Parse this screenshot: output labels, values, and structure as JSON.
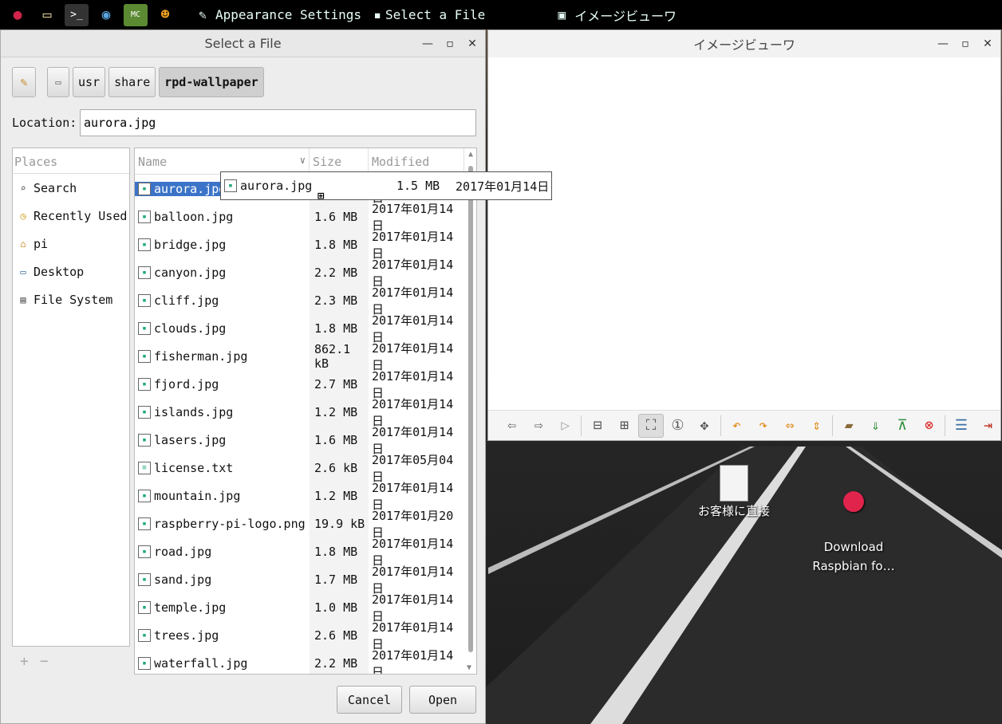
{
  "taskbar": {
    "launchers": [
      "raspberry-menu",
      "file-manager",
      "terminal",
      "chromium",
      "minecraft",
      "scratch"
    ],
    "tasks": [
      {
        "label": "Appearance Settings"
      },
      {
        "label": "Select a File"
      },
      {
        "label": "イメージビューワ"
      }
    ]
  },
  "dialog": {
    "title": "Select a File",
    "path": [
      "usr",
      "share",
      "rpd-wallpaper"
    ],
    "location_label": "Location:",
    "location_value": "aurora.jpg",
    "places_header": "Places",
    "places": [
      {
        "label": "Search",
        "icon": "search-icon"
      },
      {
        "label": "Recently Used",
        "icon": "clock-icon"
      },
      {
        "label": "pi",
        "icon": "home-folder-icon"
      },
      {
        "label": "Desktop",
        "icon": "desktop-icon"
      },
      {
        "label": "File System",
        "icon": "drive-icon"
      }
    ],
    "columns": {
      "name": "Name",
      "size": "Size",
      "modified": "Modified"
    },
    "files": [
      {
        "name": "aurora.jpg",
        "size": "1.5 MB",
        "modified": "2017年01月14日"
      },
      {
        "name": "balloon.jpg",
        "size": "1.6 MB",
        "modified": "2017年01月14日"
      },
      {
        "name": "bridge.jpg",
        "size": "1.8 MB",
        "modified": "2017年01月14日"
      },
      {
        "name": "canyon.jpg",
        "size": "2.2 MB",
        "modified": "2017年01月14日"
      },
      {
        "name": "cliff.jpg",
        "size": "2.3 MB",
        "modified": "2017年01月14日"
      },
      {
        "name": "clouds.jpg",
        "size": "1.8 MB",
        "modified": "2017年01月14日"
      },
      {
        "name": "fisherman.jpg",
        "size": "862.1 kB",
        "modified": "2017年01月14日"
      },
      {
        "name": "fjord.jpg",
        "size": "2.7 MB",
        "modified": "2017年01月14日"
      },
      {
        "name": "islands.jpg",
        "size": "1.2 MB",
        "modified": "2017年01月14日"
      },
      {
        "name": "lasers.jpg",
        "size": "1.6 MB",
        "modified": "2017年01月14日"
      },
      {
        "name": "license.txt",
        "size": "2.6 kB",
        "modified": "2017年05月04日"
      },
      {
        "name": "mountain.jpg",
        "size": "1.2 MB",
        "modified": "2017年01月14日"
      },
      {
        "name": "raspberry-pi-logo.png",
        "size": "19.9 kB",
        "modified": "2017年01月20日"
      },
      {
        "name": "road.jpg",
        "size": "1.8 MB",
        "modified": "2017年01月14日"
      },
      {
        "name": "sand.jpg",
        "size": "1.7 MB",
        "modified": "2017年01月14日"
      },
      {
        "name": "temple.jpg",
        "size": "1.0 MB",
        "modified": "2017年01月14日"
      },
      {
        "name": "trees.jpg",
        "size": "2.6 MB",
        "modified": "2017年01月14日"
      },
      {
        "name": "waterfall.jpg",
        "size": "2.2 MB",
        "modified": "2017年01月14日"
      }
    ],
    "drag_tip": {
      "name": "aurora.jpg",
      "size": "1.5 MB",
      "modified": "2017年01月14日"
    },
    "cancel_label": "Cancel",
    "open_label": "Open",
    "places_add": "+",
    "places_remove": "−"
  },
  "viewer": {
    "title": "イメージビューワ"
  },
  "desktop": {
    "icons": [
      {
        "label": "お客様に直接"
      },
      {
        "label": "Download\nRaspbian fo…"
      }
    ]
  }
}
